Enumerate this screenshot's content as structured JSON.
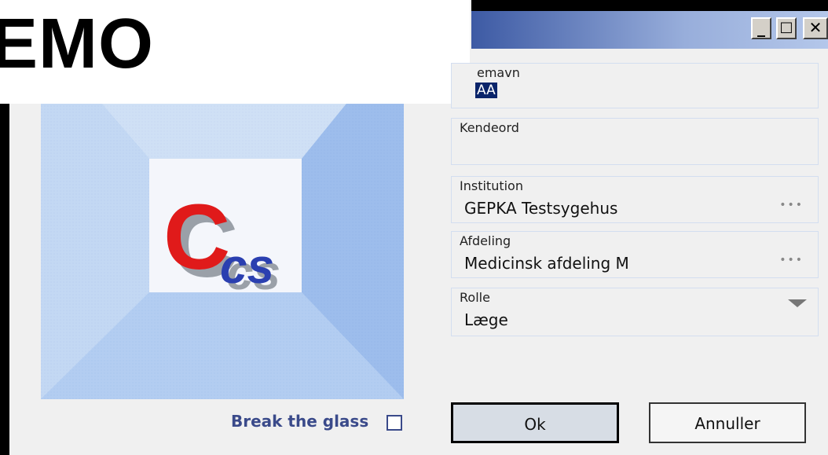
{
  "watermark": {
    "text": "EMO"
  },
  "titlebar": {
    "minimize": "_",
    "maximize": "□",
    "close": "✕"
  },
  "logo": {
    "big_letter": "C",
    "small_letters": "cs"
  },
  "fields": {
    "username": {
      "label": "emavn",
      "value": "AA"
    },
    "password": {
      "label": "Kendeord",
      "value": ""
    },
    "institution": {
      "label": "Institution",
      "value": "GEPKA Testsygehus",
      "more": "•••"
    },
    "department": {
      "label": "Afdeling",
      "value": "Medicinsk afdeling M",
      "more": "•••"
    },
    "role": {
      "label": "Rolle",
      "value": "Læge"
    }
  },
  "break_the_glass": {
    "label": "Break the glass",
    "checked": false
  },
  "buttons": {
    "ok": "Ok",
    "cancel": "Annuller"
  },
  "colors": {
    "title_gradient_start": "#3d5aa4",
    "title_gradient_end": "#b4c7ea",
    "logo_red": "#e01a1a",
    "logo_blue": "#2a3fb0",
    "break_glass_text": "#3a4a8a"
  }
}
